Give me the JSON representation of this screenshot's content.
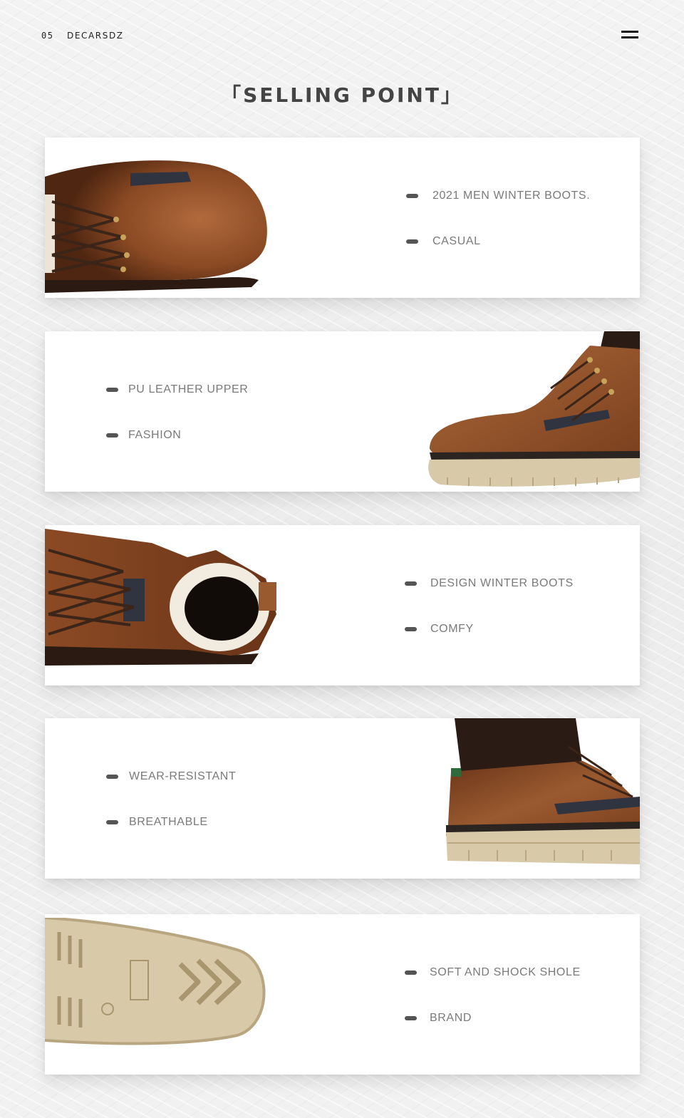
{
  "header": {
    "page_number": "05",
    "brand": "DECARSDZ"
  },
  "title": "「SELLING POINT」",
  "cards": [
    {
      "image": "boot-toe-top-view",
      "features": [
        "2021 MEN WINTER BOOTS.",
        "CASUAL"
      ]
    },
    {
      "image": "boot-side-toe-view",
      "features": [
        "PU LEATHER UPPER",
        "FASHION"
      ]
    },
    {
      "image": "boot-fur-lining-view",
      "features": [
        "DESIGN WINTER BOOTS",
        "COMFY"
      ]
    },
    {
      "image": "boot-heel-collar-view",
      "features": [
        "WEAR-RESISTANT",
        "BREATHABLE"
      ]
    },
    {
      "image": "boot-outsole-view",
      "features": [
        "SOFT AND SHOCK SHOLE",
        "BRAND"
      ]
    }
  ],
  "colors": {
    "leather": "#8b4a24",
    "leather_dark": "#5a2c14",
    "sole": "#d8c9a8",
    "lace": "#3b2418",
    "background": "#efefef"
  }
}
